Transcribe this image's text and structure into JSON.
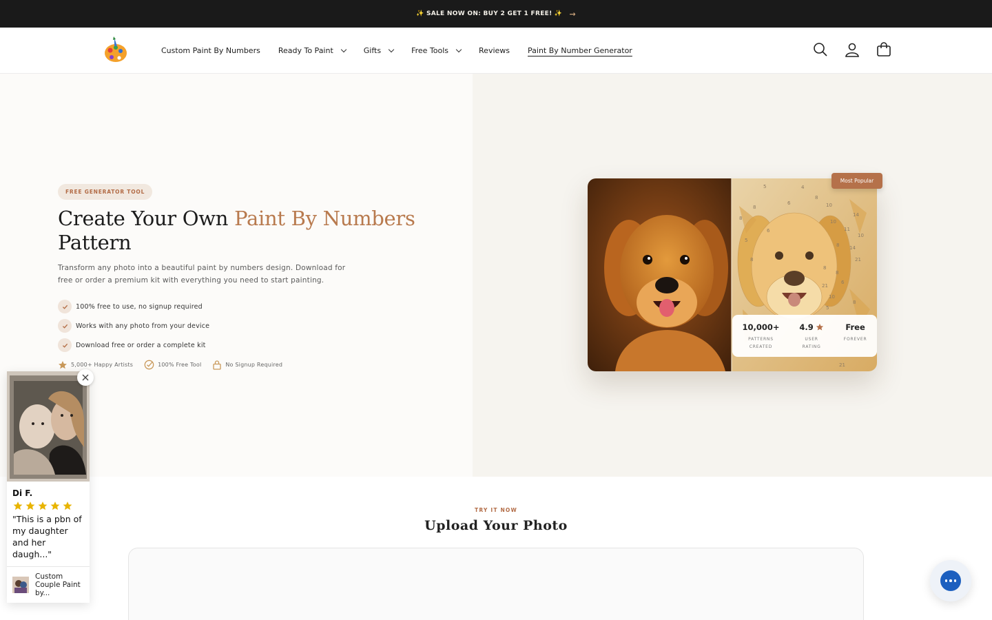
{
  "announcement": {
    "text": "✨ SALE NOW ON: BUY 2 GET 1 FREE! ✨",
    "arrow": "→"
  },
  "nav": {
    "items": [
      {
        "label": "Custom Paint By Numbers",
        "dropdown": false
      },
      {
        "label": "Ready To Paint",
        "dropdown": true
      },
      {
        "label": "Gifts",
        "dropdown": true
      },
      {
        "label": "Free Tools",
        "dropdown": true
      },
      {
        "label": "Reviews",
        "dropdown": false
      },
      {
        "label": "Paint By Number Generator",
        "dropdown": false,
        "active": true
      }
    ],
    "icons": [
      "search-icon",
      "account-icon",
      "cart-icon"
    ]
  },
  "hero": {
    "pill": "FREE GENERATOR TOOL",
    "headline_part1": "Create Your Own ",
    "headline_accent": "Paint By Numbers",
    "headline_part2": "Pattern",
    "subtitle": "Transform any photo into a beautiful paint by numbers design. Download for free or order a premium kit with everything you need to start painting.",
    "features": [
      "100% free to use, no signup required",
      "Works with any photo from your device",
      "Download free or order a complete kit"
    ],
    "trust": [
      {
        "icon": "star-icon",
        "label": "5,000+ Happy Artists"
      },
      {
        "icon": "check-circle-icon",
        "label": "100% Free Tool"
      },
      {
        "icon": "lock-icon",
        "label": "No Signup Required"
      }
    ],
    "badge": "Most Popular",
    "stats": [
      {
        "value": "10,000+",
        "label1": "PATTERNS",
        "label2": "CREATED"
      },
      {
        "value": "4.9",
        "label1": "USER",
        "label2": "RATING"
      },
      {
        "value": "Free",
        "label1": "FOREVER",
        "label2": ""
      }
    ],
    "pattern_numbers": [
      "5",
      "4",
      "8",
      "6",
      "8",
      "10",
      "14",
      "8",
      "10",
      "11",
      "6",
      "10",
      "5",
      "8",
      "14",
      "21",
      "8",
      "8",
      "8",
      "21",
      "10",
      "6",
      "5",
      "8",
      "21"
    ]
  },
  "review": {
    "name": "Di F.",
    "rating": 5,
    "text": "\"This is a pbn of my daughter and her daugh...\"",
    "product": "Custom Couple Paint by..."
  },
  "upload": {
    "eyebrow": "TRY IT NOW",
    "title": "Upload Your Photo"
  },
  "colors": {
    "accent": "#b87a4e",
    "announcement_bg": "#1a1a1a",
    "chat": "#1c5fbf",
    "star": "#e8b400"
  }
}
